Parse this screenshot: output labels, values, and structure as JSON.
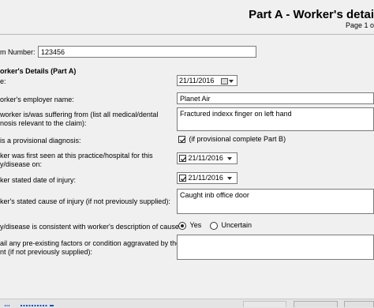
{
  "header": {
    "title": "Part A - Worker's detai",
    "page_info": "Page 1 o"
  },
  "form": {
    "claim_number_label": "m Number:",
    "claim_number_value": "123456",
    "section_title": "orker's Details (Part A)",
    "date_label": "e:",
    "date_value": "21/11/2016",
    "employer_label": "orker's employer name:",
    "employer_value": "Planet Air",
    "condition_label_1": "worker is/was suffering from (list all medical/dental",
    "condition_label_2": "nosis relevant to the claim):",
    "condition_value": "Fractured indexx finger on left hand",
    "provisional_label": "is a provisional diagnosis:",
    "provisional_checkbox_label": "(if provisional complete Part B)",
    "first_seen_label_1": "ker was first seen at this practice/hospital for this",
    "first_seen_label_2": "y/disease on:",
    "first_seen_value": "21/11/2016",
    "injury_date_label": "ker stated date of injury:",
    "injury_date_value": "21/11/2016",
    "cause_label": "ker's stated cause of injury (if not previously supplied):",
    "cause_value": "Caught inb office door",
    "consistent_label": "y/disease is consistent with worker's description of cause:",
    "consistent_yes": "Yes",
    "consistent_uncertain": "Uncertain",
    "preexisting_label_1": "ail any pre-existing factors or condition aggravated by the",
    "preexisting_label_2": "nt (if not previously supplied):",
    "preexisting_value": ""
  },
  "colors": {
    "background": "#f0f0f0",
    "field_bg": "#ffffff",
    "link": "#1a4fc4"
  },
  "icons": [
    "calendar-icon",
    "dropdown-arrow-icon",
    "checkmark-icon"
  ]
}
